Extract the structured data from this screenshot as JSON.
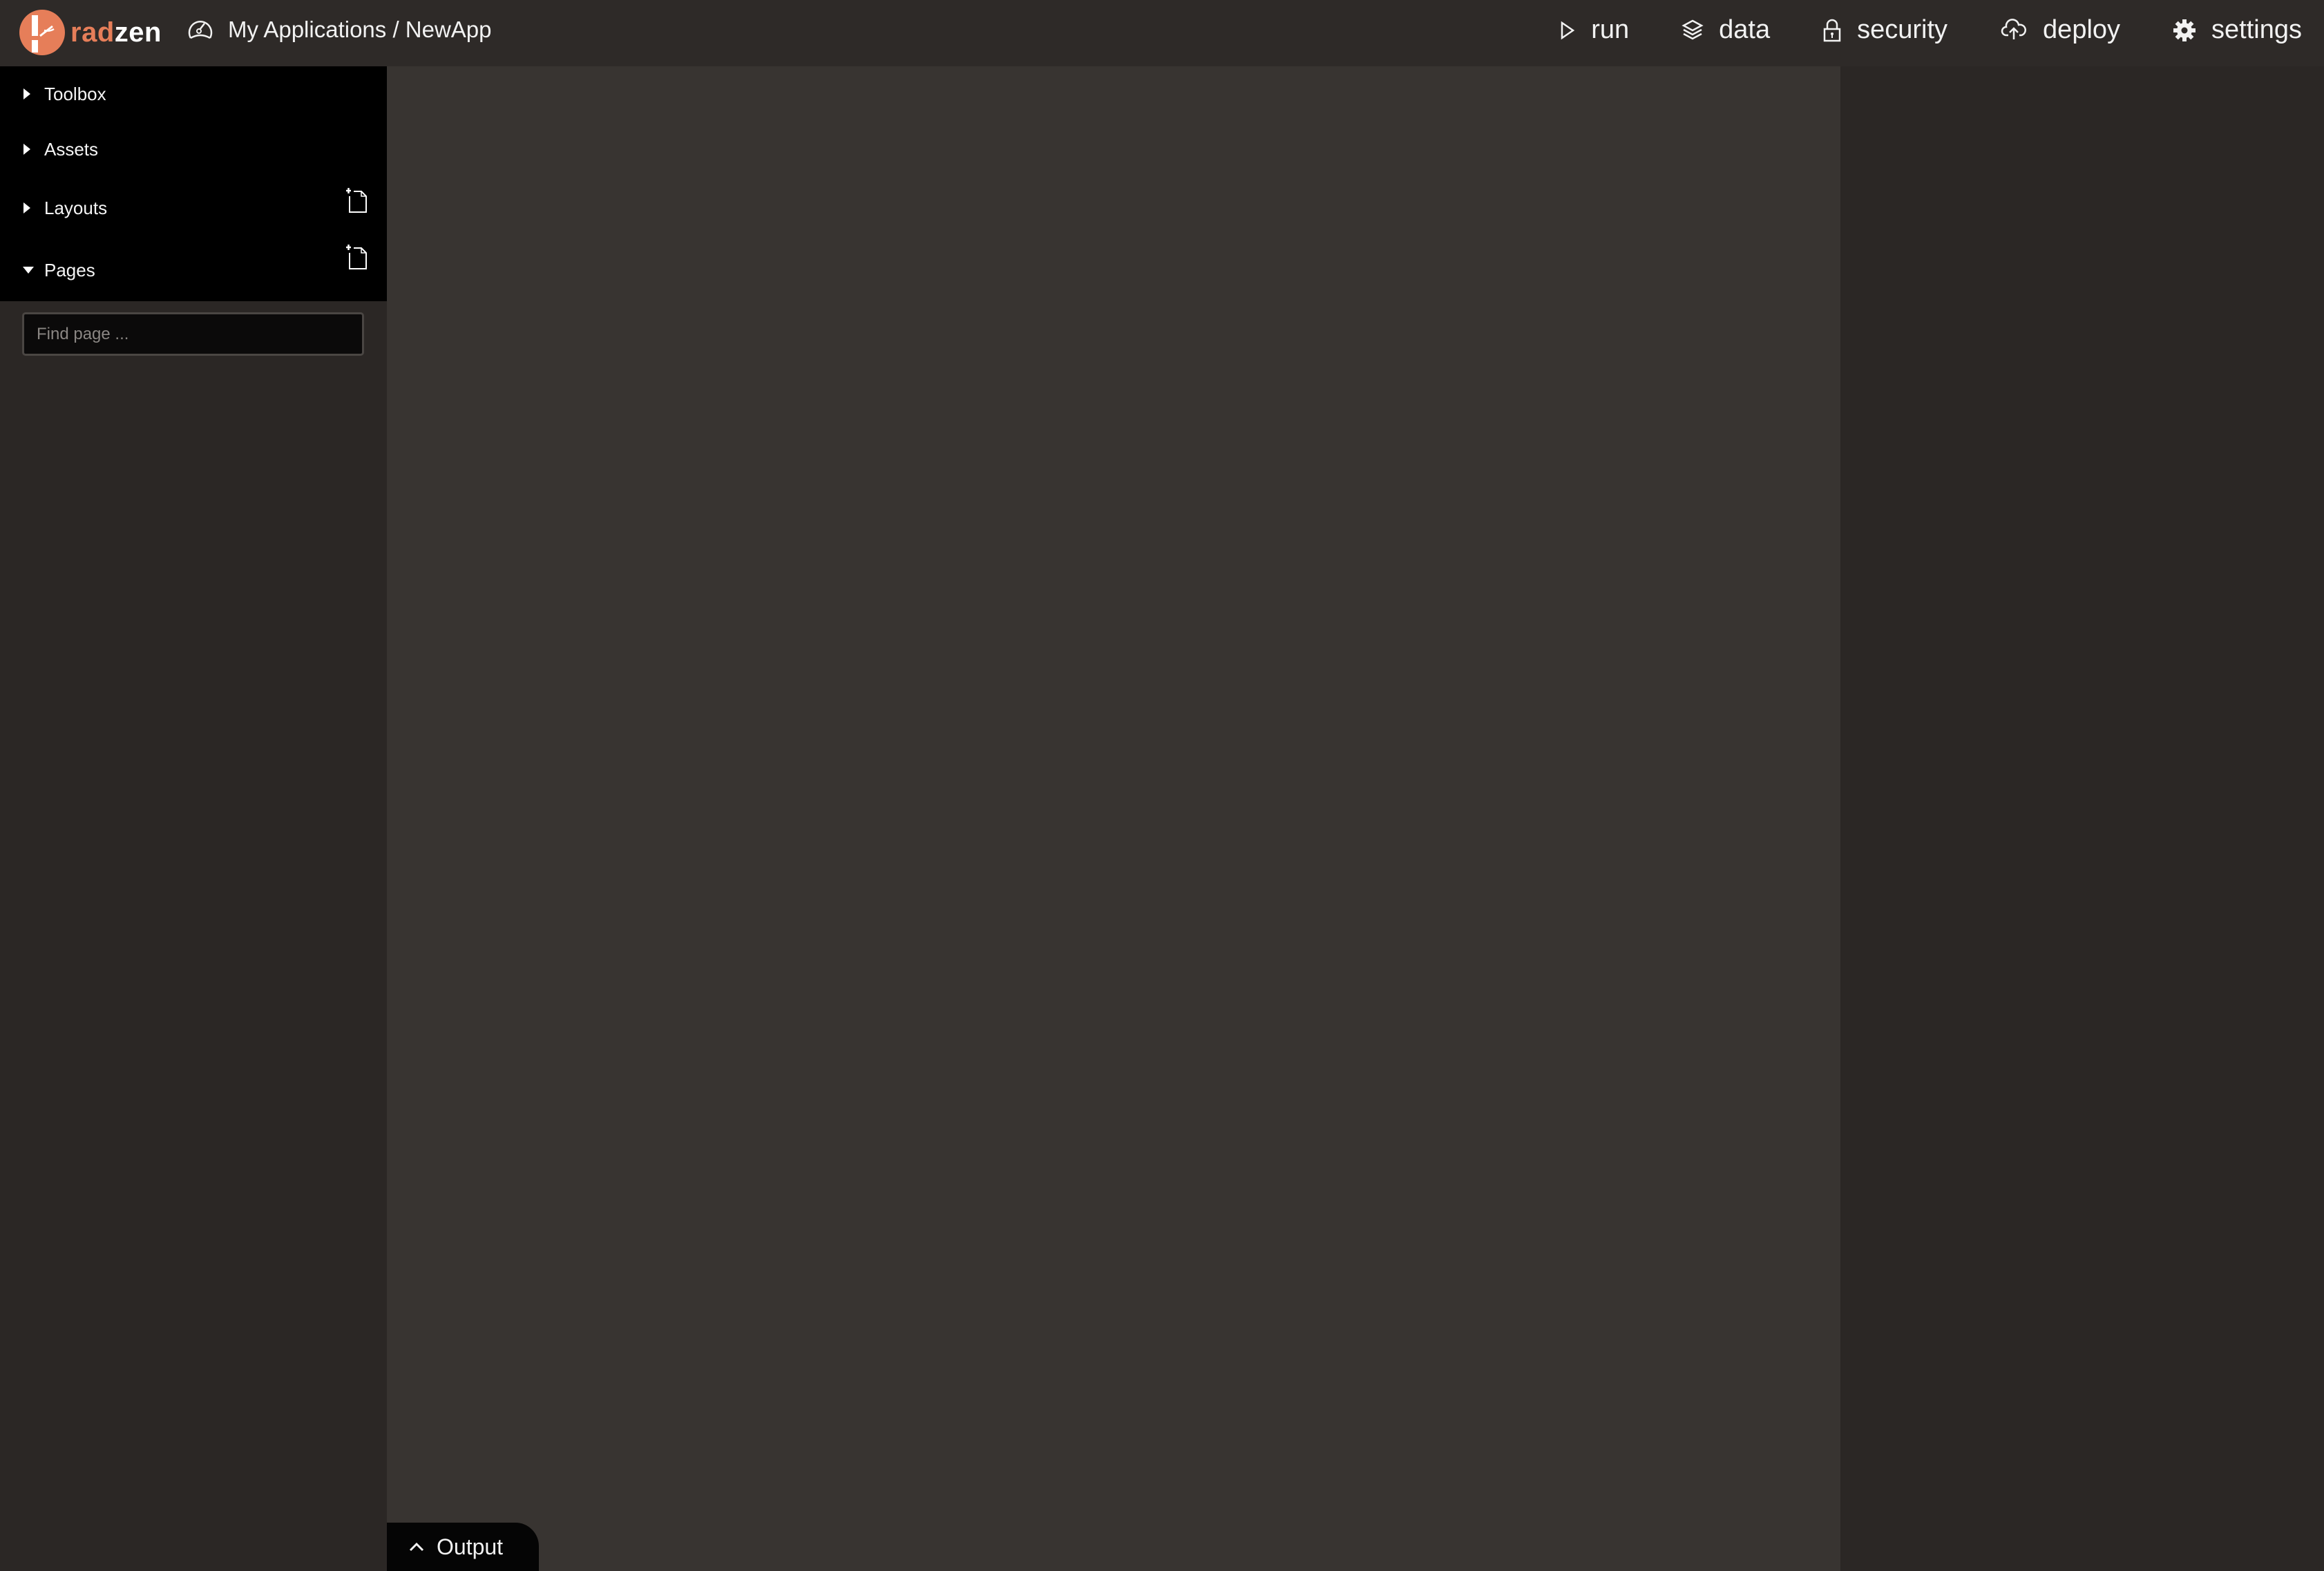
{
  "app": {
    "brand_prefix": "rad",
    "brand_suffix": "zen",
    "brand_color": "#e67e59"
  },
  "header": {
    "breadcrumb_icon": "dashboard-gauge-icon",
    "breadcrumb": "My Applications / NewApp",
    "nav": [
      {
        "label": "run",
        "icon": "play-icon"
      },
      {
        "label": "data",
        "icon": "layers-icon"
      },
      {
        "label": "security",
        "icon": "lock-icon"
      },
      {
        "label": "deploy",
        "icon": "cloud-upload-icon"
      },
      {
        "label": "settings",
        "icon": "gear-icon"
      }
    ]
  },
  "sidebar": {
    "panels": [
      {
        "label": "Toolbox",
        "expanded": false,
        "has_add": false
      },
      {
        "label": "Assets",
        "expanded": false,
        "has_add": false
      },
      {
        "label": "Layouts",
        "expanded": false,
        "has_add": true
      },
      {
        "label": "Pages",
        "expanded": true,
        "has_add": true
      }
    ],
    "search": {
      "value": "",
      "placeholder": "Find page ..."
    }
  },
  "output": {
    "label": "Output",
    "icon": "chevron-up-icon"
  }
}
